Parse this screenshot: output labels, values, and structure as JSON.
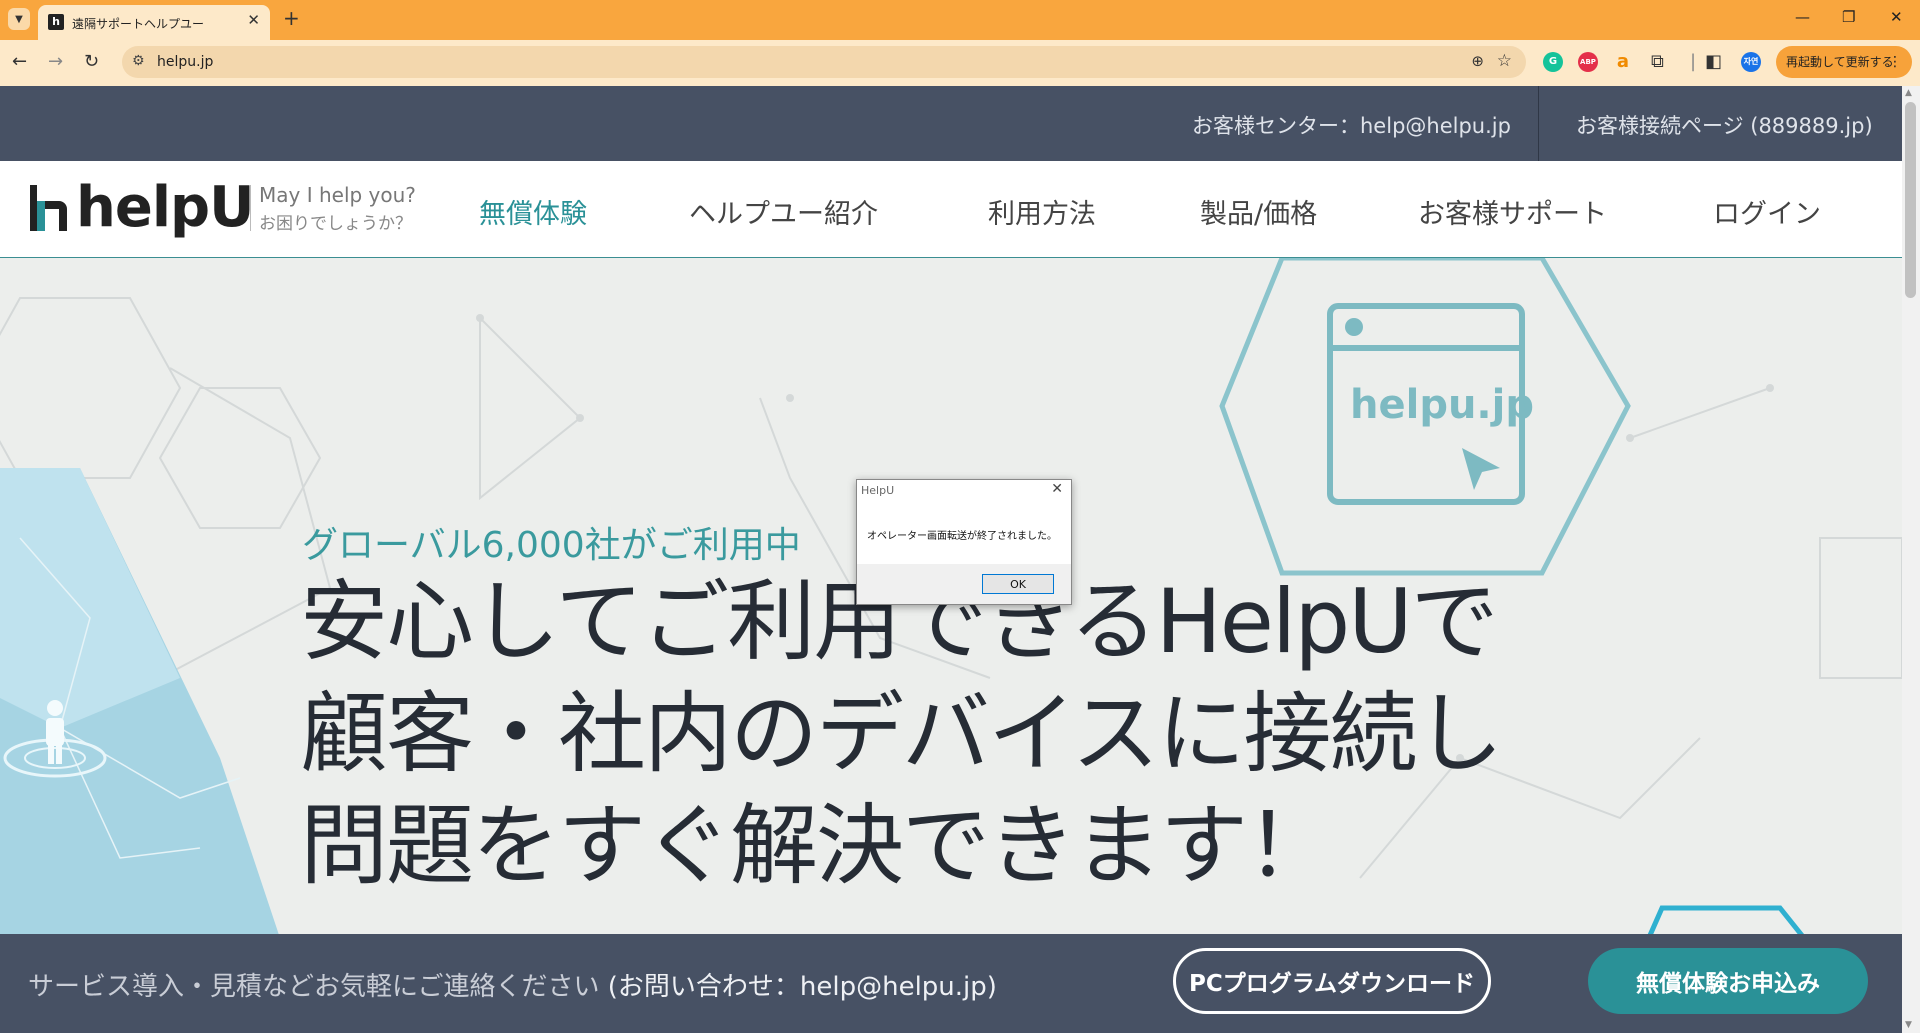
{
  "browser": {
    "tab_title": "遠隔サポートヘルプユー",
    "new_tab": "+",
    "url": "helpu.jp",
    "restart_label": "再起動して更新する",
    "window_controls": [
      "—",
      "❐",
      "✕"
    ],
    "extensions": [
      {
        "name": "grammarly-icon",
        "label": "G",
        "color": "#15c39a"
      },
      {
        "name": "adblock-icon",
        "label": "ABP",
        "color": "#e4304a"
      },
      {
        "name": "amazon-icon",
        "label": "a",
        "color": "#f7a23a"
      },
      {
        "name": "translate-icon",
        "label": "자연",
        "color": "#1a73e8"
      }
    ]
  },
  "site": {
    "topbar": {
      "support_center": "お客様センター：help@helpu.jp",
      "customer_connect": "お客様接続ページ (889889.jp)"
    },
    "logo": {
      "mark": "h",
      "text": "helpU",
      "tagline_en": "May I help you?",
      "tagline_ja": "お困りでしょうか？"
    },
    "nav": [
      {
        "label": "無償体験",
        "active": true
      },
      {
        "label": "ヘルプユー紹介",
        "active": false
      },
      {
        "label": "利用方法",
        "active": false
      },
      {
        "label": "製品/価格",
        "active": false
      },
      {
        "label": "お客様サポート",
        "active": false
      },
      {
        "label": "ログイン",
        "active": false
      }
    ],
    "hero": {
      "subtitle": "グローバル6,000社がご利用中",
      "title_lines": [
        "安心してご利用できるHelpUで",
        "顧客・社内のデバイスに接続し",
        "問題をすぐ解決できます！"
      ],
      "illustration_text": "helpu.jp"
    },
    "footer": {
      "text_main": "サービス導入・見積などお気軽にご連絡ください",
      "text_contact": "(お問い合わせ：help@helpu.jp)",
      "download_button": "PCプログラムダウンロード",
      "trial_button": "無償体験お申込み"
    }
  },
  "dialog": {
    "title": "HelpU",
    "message": "オペレーター画面転送が終了されました。",
    "ok_label": "OK"
  },
  "colors": {
    "accent_teal": "#2a9197",
    "dark_bar": "#475164",
    "tab_orange": "#f9a63e"
  }
}
